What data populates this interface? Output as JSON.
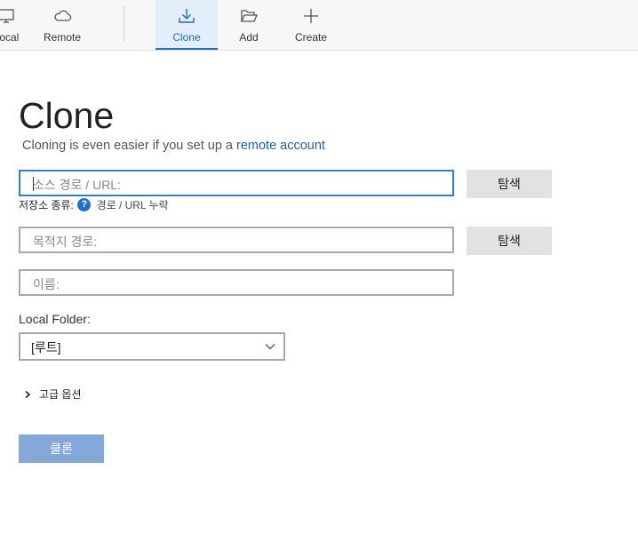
{
  "toolbar": {
    "local_label": "Local",
    "remote_label": "Remote",
    "clone_label": "Clone",
    "add_label": "Add",
    "create_label": "Create",
    "active_color": "#1f6fb8"
  },
  "main": {
    "title": "Clone",
    "subtitle_text": "Cloning is even easier if you set up a",
    "subtitle_link": "remote account",
    "source_placeholder": "소스 경로 / URL:",
    "browse_label": "탐색",
    "repo_type_label": "저장소 종류:",
    "repo_type_value": "경로 / URL 누락",
    "destination_placeholder": "목적지 경로:",
    "name_placeholder": "이름:",
    "local_folder_label": "Local Folder:",
    "local_folder_value": "[루트]",
    "advanced_label": "고급 옵션",
    "clone_button_label": "클론",
    "clone_button_color": "#85a8d8"
  }
}
